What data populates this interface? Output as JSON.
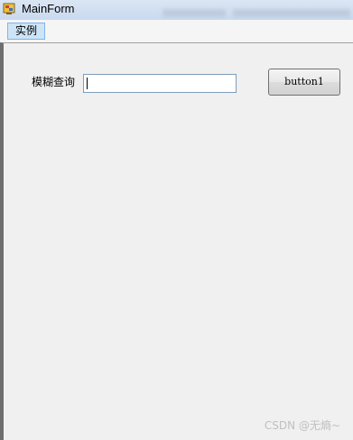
{
  "window": {
    "title": "MainForm"
  },
  "menu": {
    "items": [
      {
        "label": "实例"
      }
    ]
  },
  "form": {
    "search_label": "模糊查询",
    "search_value": "",
    "button_label": "button1"
  },
  "watermark": "CSDN @无熵~",
  "colors": {
    "titlebar": "#c9d9ee",
    "menu_highlight": "#cde4f7",
    "background": "#f0f0f0"
  }
}
